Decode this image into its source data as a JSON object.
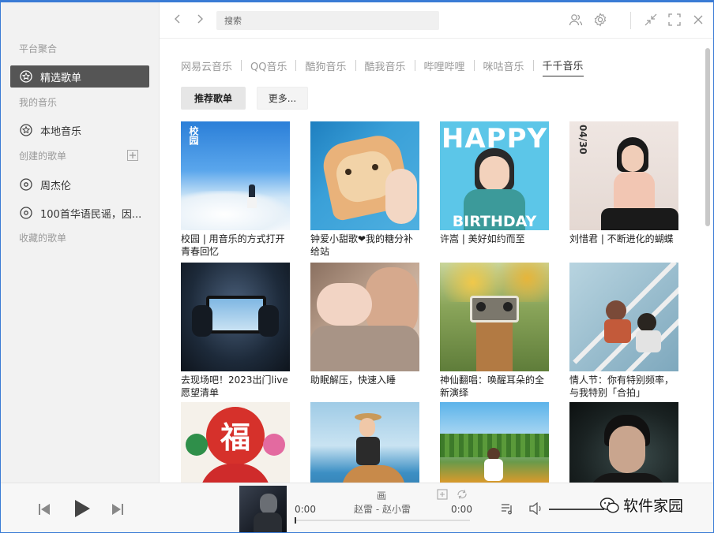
{
  "sidebar": {
    "section_platform": "平台聚合",
    "section_my_music": "我的音乐",
    "section_created": "创建的歌单",
    "section_collected": "收藏的歌单",
    "items": [
      {
        "label": "精选歌单",
        "icon": "star-circle-icon"
      },
      {
        "label": "本地音乐",
        "icon": "star-circle-icon"
      },
      {
        "label": "周杰伦",
        "icon": "disc-icon"
      },
      {
        "label": "100首华语民谣，因...",
        "icon": "disc-icon"
      }
    ]
  },
  "topbar": {
    "search_placeholder": "搜索"
  },
  "tabs": [
    "网易云音乐",
    "QQ音乐",
    "酷狗音乐",
    "酷我音乐",
    "哔哩哔哩",
    "咪咕音乐",
    "千千音乐"
  ],
  "active_tab": "千千音乐",
  "category_buttons": {
    "recommend": "推荐歌单",
    "more": "更多..."
  },
  "playlists": [
    {
      "title": "校园 | 用音乐的方式打开青春回忆",
      "cover_text": "校园"
    },
    {
      "title": "钟爱小甜歌❤我的糖分补给站"
    },
    {
      "title": "许嵩 | 美好如约而至",
      "cover_text_top": "HAPPY",
      "cover_text_bottom": "BIRTHDAY"
    },
    {
      "title": "刘惜君 | 不断进化的蝴蝶",
      "cover_text": "04/30"
    },
    {
      "title": "去现场吧！2023出门live愿望清单"
    },
    {
      "title": "助眠解压，快速入睡"
    },
    {
      "title": "神仙翻唱：唤醒耳朵的全新演绎"
    },
    {
      "title": "情人节：你有特别频率，与我特别「合拍」"
    },
    {
      "title": "",
      "cover_text": "福"
    },
    {
      "title": ""
    },
    {
      "title": ""
    },
    {
      "title": ""
    }
  ],
  "player": {
    "time_current": "0:00",
    "time_total": "0:00",
    "song": "赵雷 - 赵小雷",
    "lyric_label": "画",
    "progress": 0.0
  },
  "watermark": "软件家园",
  "colors": {
    "accent": "#3a7bd5",
    "active_item_bg": "#555555"
  }
}
